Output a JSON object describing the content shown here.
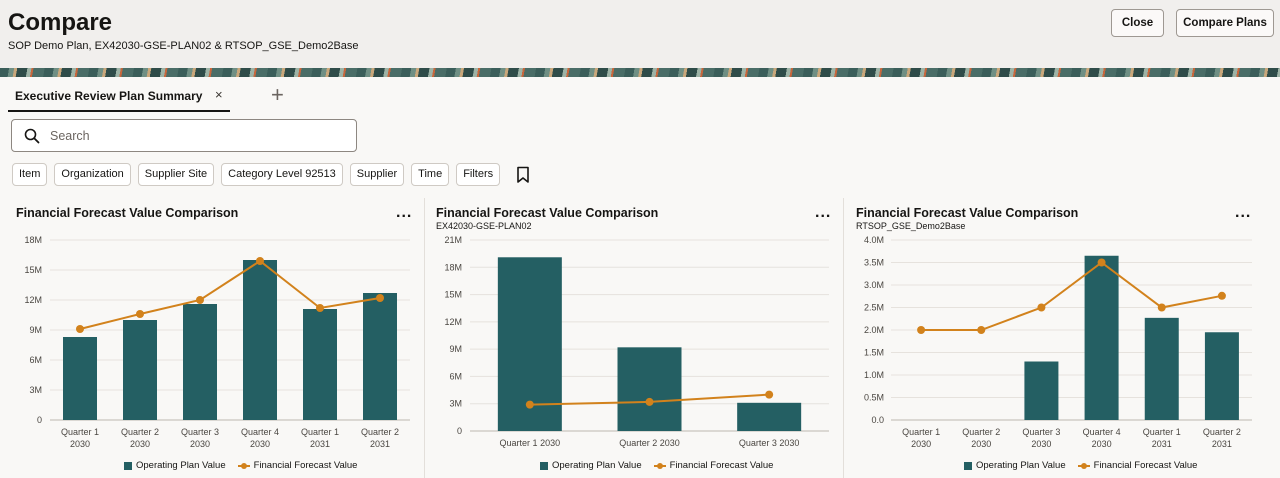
{
  "header": {
    "title": "Compare",
    "subtitle": "SOP Demo Plan, EX42030-GSE-PLAN02 & RTSOP_GSE_Demo2Base",
    "close_label": "Close",
    "compare_label": "Compare Plans"
  },
  "tabs": [
    {
      "label": "Executive Review Plan Summary",
      "close_glyph": "×"
    }
  ],
  "add_tab_glyph": "+",
  "search": {
    "placeholder": "Search",
    "value": ""
  },
  "filters": [
    "Item",
    "Organization",
    "Supplier Site",
    "Category Level 92513",
    "Supplier",
    "Time",
    "Filters"
  ],
  "colors": {
    "bar": "#245f63",
    "line": "#d2821c"
  },
  "charts": [
    {
      "more_glyph": "..."
    },
    {
      "more_glyph": "..."
    },
    {
      "more_glyph": "..."
    }
  ],
  "chart_data": [
    {
      "type": "bar",
      "title": "Financial Forecast Value Comparison",
      "subtitle": "",
      "categories": [
        [
          "Quarter 1",
          "2030"
        ],
        [
          "Quarter 2",
          "2030"
        ],
        [
          "Quarter 3",
          "2030"
        ],
        [
          "Quarter 4",
          "2030"
        ],
        [
          "Quarter 1",
          "2031"
        ],
        [
          "Quarter 2",
          "2031"
        ]
      ],
      "y_ticks": [
        "18M",
        "15M",
        "12M",
        "9M",
        "6M",
        "3M",
        "0"
      ],
      "ylim": [
        0,
        18000000
      ],
      "series": [
        {
          "name": "Operating Plan Value",
          "kind": "bar",
          "values": [
            8300000,
            10000000,
            11600000,
            16000000,
            11100000,
            12700000
          ]
        },
        {
          "name": "Financial Forecast Value",
          "kind": "line",
          "values": [
            9100000,
            10600000,
            12000000,
            15900000,
            11200000,
            12200000
          ]
        }
      ],
      "legend": "bottom"
    },
    {
      "type": "bar",
      "title": "Financial Forecast Value Comparison",
      "subtitle": "EX42030-GSE-PLAN02",
      "categories": [
        [
          "Quarter 1 2030"
        ],
        [
          "Quarter 2 2030"
        ],
        [
          "Quarter 3 2030"
        ]
      ],
      "y_ticks": [
        "21M",
        "18M",
        "15M",
        "12M",
        "9M",
        "6M",
        "3M",
        "0"
      ],
      "ylim": [
        0,
        21000000
      ],
      "series": [
        {
          "name": "Operating Plan Value",
          "kind": "bar",
          "values": [
            19100000,
            9200000,
            3100000
          ]
        },
        {
          "name": "Financial Forecast Value",
          "kind": "line",
          "values": [
            2900000,
            3200000,
            4000000
          ]
        }
      ],
      "legend": "bottom"
    },
    {
      "type": "bar",
      "title": "Financial Forecast Value Comparison",
      "subtitle": "RTSOP_GSE_Demo2Base",
      "categories": [
        [
          "Quarter 1",
          "2030"
        ],
        [
          "Quarter 2",
          "2030"
        ],
        [
          "Quarter 3",
          "2030"
        ],
        [
          "Quarter 4",
          "2030"
        ],
        [
          "Quarter 1",
          "2031"
        ],
        [
          "Quarter 2",
          "2031"
        ]
      ],
      "y_ticks": [
        "4.0M",
        "3.5M",
        "3.0M",
        "2.5M",
        "2.0M",
        "1.5M",
        "1.0M",
        "0.5M",
        "0.0"
      ],
      "ylim": [
        0,
        4000000
      ],
      "series": [
        {
          "name": "Operating Plan Value",
          "kind": "bar",
          "values": [
            0,
            0,
            1300000,
            3650000,
            2270000,
            1950000
          ]
        },
        {
          "name": "Financial Forecast Value",
          "kind": "line",
          "values": [
            2000000,
            2000000,
            2500000,
            3500000,
            2500000,
            2760000
          ]
        }
      ],
      "legend": "bottom"
    }
  ]
}
